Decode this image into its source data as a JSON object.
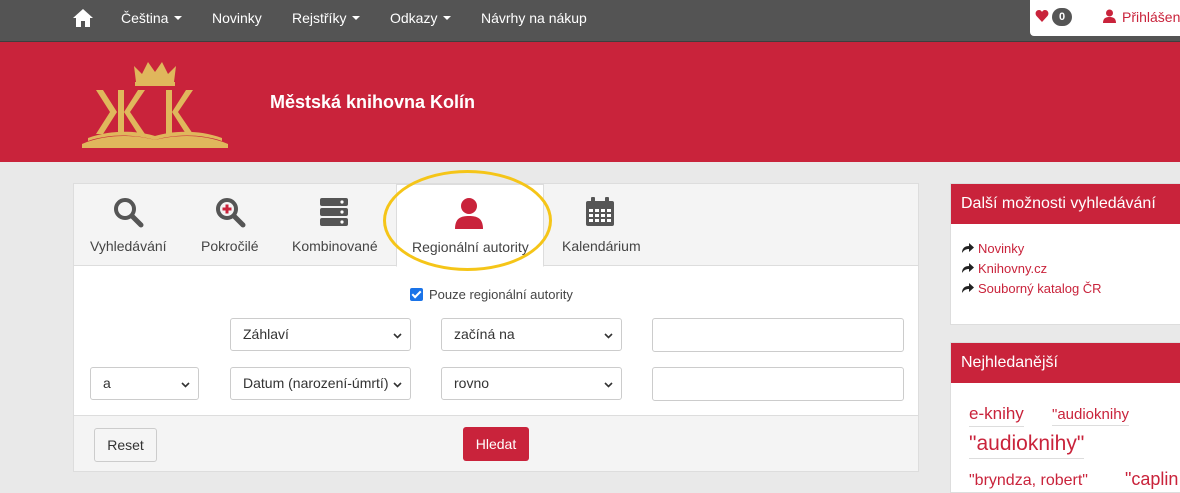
{
  "nav": {
    "items": [
      "Čeština",
      "Novinky",
      "Rejstříky",
      "Odkazy",
      "Návrhy na nákup"
    ],
    "favorites_count": "0",
    "login_label": "Přihlášení"
  },
  "header": {
    "title": "Městská knihovna Kolín"
  },
  "search": {
    "tabs": [
      "Vyhledávání",
      "Pokročilé",
      "Kombinované",
      "Regionální autority",
      "Kalendárium"
    ],
    "active_tab": "Regionální autority",
    "checkbox_label": "Pouze regionální autority",
    "rows": [
      {
        "field": "Záhlaví",
        "operator": "začíná na",
        "value": ""
      },
      {
        "connector": "a",
        "field": "Datum (narození-úmrtí)",
        "operator": "rovno",
        "value": ""
      }
    ],
    "reset_label": "Reset",
    "submit_label": "Hledat"
  },
  "sidebar": {
    "more_title": "Další možnosti vyhledávání",
    "more_links": [
      "Novinky",
      "Knihovny.cz",
      "Souborný katalog ČR"
    ],
    "popular_title": "Nejhledanější",
    "popular_tags": [
      "e-knihy",
      "\"audioknihy",
      "\"audioknihy\"",
      "\"bryndza, robert\"",
      "\"caplin"
    ]
  },
  "colors": {
    "brand": "#c9233b",
    "navbar": "#545454",
    "highlight": "#f5c518"
  }
}
